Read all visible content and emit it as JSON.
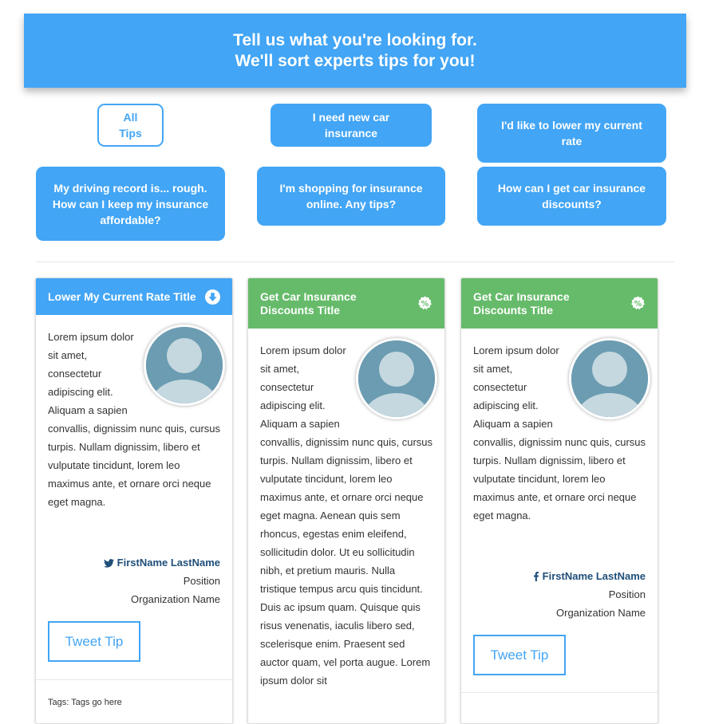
{
  "hero": {
    "line1": "Tell us what you're looking for.",
    "line2": "We'll sort experts tips for you!"
  },
  "filters": [
    {
      "label": "All Tips"
    },
    {
      "label": "I need new car insurance"
    },
    {
      "label": "I'd like to lower my current rate"
    },
    {
      "label": "My driving record is... rough. How can I keep my insurance affordable?"
    },
    {
      "label": "I'm shopping for insurance online. Any tips?"
    },
    {
      "label": "How can I get car insurance discounts?"
    }
  ],
  "cards": [
    {
      "title": "Lower My Current Rate Title",
      "icon": "download-arrow-icon",
      "header_color": "#42a5f5",
      "text": "Lorem ipsum dolor sit amet, consectetur adipiscing elit. Aliquam a sapien convallis, dignissim nunc quis, cursus turpis. Nullam dignissim, libero et vulputate tincidunt, lorem leo maximus ante, et ornare orci neque eget magna.",
      "author": {
        "social_icon": "twitter-icon",
        "name": "FirstName LastName",
        "position": "Position",
        "organization": "Organization Name"
      },
      "button_label": "Tweet Tip",
      "tags": "Tags: Tags go here"
    },
    {
      "title": "Get Car Insurance Discounts Title",
      "icon": "percent-badge-icon",
      "header_color": "#66bb6a",
      "text": "Lorem ipsum dolor sit amet, consectetur adipiscing elit. Aliquam a sapien convallis, dignissim nunc quis, cursus turpis. Nullam dignissim, libero et vulputate tincidunt, lorem leo maximus ante, et ornare orci neque eget magna. Aenean quis sem rhoncus, egestas enim eleifend, sollicitudin dolor. Ut eu sollicitudin nibh, et pretium mauris. Nulla tristique tempus arcu quis tincidunt. Duis ac ipsum quam. Quisque quis risus venenatis, iaculis libero sed, scelerisque enim. Praesent sed auctor quam, vel porta augue. Lorem ipsum dolor sit"
    },
    {
      "title": "Get Car Insurance Discounts Title",
      "icon": "percent-badge-icon",
      "header_color": "#66bb6a",
      "text": "Lorem ipsum dolor sit amet, consectetur adipiscing elit. Aliquam a sapien convallis, dignissim nunc quis, cursus turpis. Nullam dignissim, libero et vulputate tincidunt, lorem leo maximus ante, et ornare orci neque eget magna.",
      "author": {
        "social_icon": "facebook-icon",
        "name": "FirstName LastName",
        "position": "Position",
        "organization": "Organization Name"
      },
      "button_label": "Tweet Tip"
    }
  ]
}
